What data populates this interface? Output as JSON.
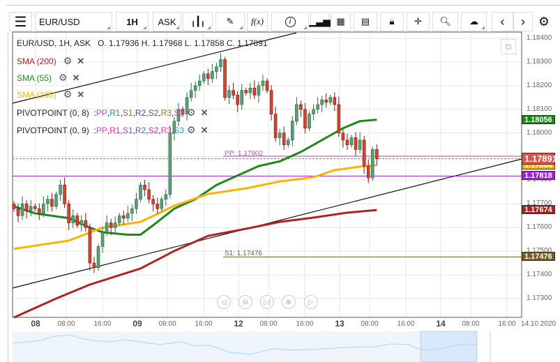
{
  "toolbar": {
    "symbol": "EUR/USD",
    "interval": "1H",
    "price_type": "ASK",
    "fx_label": "f(x)",
    "icons": [
      "menu-icon",
      "candlestick-icon",
      "pen-icon",
      "function-icon",
      "info-icon",
      "bar-chart-icon",
      "calendar-icon",
      "report-icon",
      "lock-icon",
      "crosshair-icon",
      "zoom-icon",
      "cloud-upload-icon",
      "chevron-left-icon",
      "chevron-right-icon",
      "gear-icon"
    ]
  },
  "header": {
    "ohlc": "EUR/USD, 1H, ASK   O. 1.17936 H. 1.17968 L. 1.17858 C. 1.17891"
  },
  "indicators": [
    {
      "label": "SMA (200)",
      "color": "#b22222"
    },
    {
      "label": "SMA (55)",
      "color": "#1a8a1a"
    },
    {
      "label": "SMA (100)",
      "color": "#ffb300"
    }
  ],
  "pivots": [
    {
      "label": "PIVOTPOINT (0, 8)",
      "parts": [
        {
          "t": "PP",
          "c": "#d63fd6"
        },
        {
          "t": "R1",
          "c": "#1aa06a"
        },
        {
          "t": "S1",
          "c": "#a07020"
        },
        {
          "t": "R2",
          "c": "#3050c0"
        },
        {
          "t": "S2",
          "c": "#7a3a9a"
        },
        {
          "t": "R3",
          "c": "#a07020"
        },
        {
          "t": "S3",
          "c": "#e040e0"
        }
      ]
    },
    {
      "label": "PIVOTPOINT (0, 9)",
      "parts": [
        {
          "t": "PP",
          "c": "#d040d0"
        },
        {
          "t": "R1",
          "c": "#e020c0"
        },
        {
          "t": "S1",
          "c": "#b040c0"
        },
        {
          "t": "R2",
          "c": "#6060d0"
        },
        {
          "t": "S2",
          "c": "#c03070"
        },
        {
          "t": "R3",
          "c": "#d040a0"
        },
        {
          "t": "S3",
          "c": "#30a0c0"
        }
      ]
    }
  ],
  "pivot_lines": {
    "pp": "PP: 1.17902",
    "s1": "S1: 1.17476"
  },
  "price_tags": [
    {
      "value": "1.18056",
      "color": "#138a13"
    },
    {
      "value": "1.17891",
      "color": "#d9534f"
    },
    {
      "value": "1.17864",
      "color": "#ffb300"
    },
    {
      "value": "1.17818",
      "color": "#a020d0"
    },
    {
      "value": "1.17674",
      "color": "#a52020"
    },
    {
      "value": "1.17476",
      "color": "#7a5a20"
    }
  ],
  "time_axis": [
    {
      "t": "08",
      "day": true
    },
    {
      "t": "08:00"
    },
    {
      "t": "16:00"
    },
    {
      "t": "09",
      "day": true
    },
    {
      "t": "08:00"
    },
    {
      "t": "16:00"
    },
    {
      "t": "12",
      "day": true
    },
    {
      "t": "08:00"
    },
    {
      "t": "16:00"
    },
    {
      "t": "13",
      "day": true
    },
    {
      "t": "08:00"
    },
    {
      "t": "16:00"
    },
    {
      "t": "14",
      "day": true
    },
    {
      "t": "08:00"
    },
    {
      "t": "16:00"
    },
    {
      "t": "14.10.2020"
    }
  ],
  "chart_data": {
    "type": "candlestick",
    "symbol": "EUR/USD",
    "interval": "1H",
    "ylim": [
      1.172,
      1.185
    ],
    "yticks": [
      "1.18400",
      "1.18300",
      "1.18200",
      "1.18100",
      "1.18000",
      "1.17900",
      "1.17800",
      "1.17700",
      "1.17600",
      "1.17500",
      "1.17400",
      "1.17300"
    ],
    "closes": [
      1.1768,
      1.1765,
      1.177,
      1.1767,
      1.1769,
      1.1768,
      1.1766,
      1.177,
      1.1772,
      1.1769,
      1.1774,
      1.1778,
      1.177,
      1.1762,
      1.1765,
      1.1761,
      1.1763,
      1.176,
      1.1745,
      1.1743,
      1.1752,
      1.1758,
      1.1762,
      1.176,
      1.1762,
      1.1765,
      1.1764,
      1.1766,
      1.1768,
      1.1772,
      1.1778,
      1.1776,
      1.1772,
      1.177,
      1.1768,
      1.1772,
      1.1774,
      1.18,
      1.1805,
      1.181,
      1.1808,
      1.1815,
      1.1818,
      1.182,
      1.1822,
      1.1825,
      1.1823,
      1.1826,
      1.1828,
      1.1831,
      1.1815,
      1.1818,
      1.1816,
      1.1812,
      1.1818,
      1.1817,
      1.1819,
      1.1816,
      1.182,
      1.1822,
      1.1818,
      1.1808,
      1.1798,
      1.18,
      1.1795,
      1.1797,
      1.1805,
      1.1812,
      1.181,
      1.1802,
      1.1808,
      1.181,
      1.1812,
      1.1814,
      1.1813,
      1.1815,
      1.1812,
      1.18,
      1.1797,
      1.1795,
      1.1798,
      1.1793,
      1.1797,
      1.1786,
      1.1781,
      1.1793,
      1.17891
    ],
    "sma": [
      {
        "name": "SMA (55)",
        "color": "#1a8a1a",
        "points": [
          [
            0,
            1.1769
          ],
          [
            5,
            1.1766
          ],
          [
            13,
            1.1764
          ],
          [
            18,
            1.176
          ],
          [
            21,
            1.1758
          ],
          [
            27,
            1.1757
          ],
          [
            30,
            1.1757
          ],
          [
            33,
            1.1761
          ],
          [
            38,
            1.1768
          ],
          [
            43,
            1.1772
          ],
          [
            48,
            1.1778
          ],
          [
            53,
            1.1782
          ],
          [
            58,
            1.1786
          ],
          [
            63,
            1.1788
          ],
          [
            68,
            1.1792
          ],
          [
            73,
            1.1797
          ],
          [
            78,
            1.1802
          ],
          [
            82,
            1.1805
          ],
          [
            86,
            1.18056
          ]
        ]
      },
      {
        "name": "SMA (100)",
        "color": "#ffb300",
        "points": [
          [
            0,
            1.1751
          ],
          [
            13,
            1.17545
          ],
          [
            21,
            1.176
          ],
          [
            30,
            1.17624
          ],
          [
            38,
            1.17692
          ],
          [
            46,
            1.17742
          ],
          [
            55,
            1.17766
          ],
          [
            63,
            1.17795
          ],
          [
            71,
            1.17813
          ],
          [
            76,
            1.17843
          ],
          [
            83,
            1.1786
          ],
          [
            86,
            1.17864
          ]
        ]
      },
      {
        "name": "SMA (200)",
        "color": "#b22222",
        "points": [
          [
            0,
            1.1722
          ],
          [
            10,
            1.173
          ],
          [
            18,
            1.17359
          ],
          [
            30,
            1.17427
          ],
          [
            38,
            1.17501
          ],
          [
            46,
            1.17565
          ],
          [
            55,
            1.17595
          ],
          [
            63,
            1.17624
          ],
          [
            71,
            1.17642
          ],
          [
            79,
            1.17663
          ],
          [
            86,
            1.17674
          ]
        ]
      }
    ],
    "levels": {
      "pp": 1.17902,
      "s1": 1.17476,
      "purple": 1.17818,
      "last": 1.17891
    }
  }
}
